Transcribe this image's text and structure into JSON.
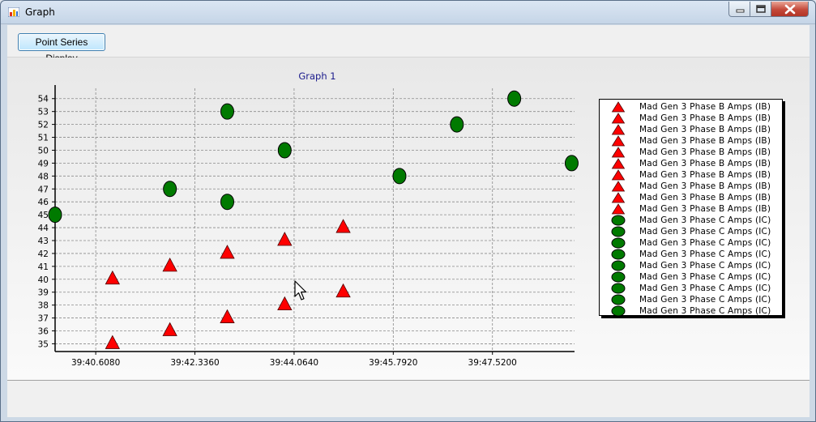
{
  "window": {
    "title": "Graph",
    "minimize_icon": "minimize-icon",
    "maximize_icon": "maximize-icon",
    "close_icon": "close-icon"
  },
  "toolbar": {
    "point_series_label": "Point Series Display"
  },
  "colors": {
    "triangle": "#ff0000",
    "circle": "#007a00",
    "grid": "#8a8a8a",
    "title": "#1a1a8c",
    "close_button": "#c4493a"
  },
  "chart_data": {
    "type": "scatter",
    "title": "Graph 1",
    "xlabel": "",
    "ylabel": "",
    "x_tick_labels": [
      "39:40.6080",
      "39:42.3360",
      "39:44.0640",
      "39:45.7920",
      "39:47.5200"
    ],
    "x_ticks": [
      40.608,
      42.336,
      44.064,
      45.792,
      47.52
    ],
    "xlim": [
      39.9,
      48.95
    ],
    "ylim": [
      34.4,
      54.8
    ],
    "y_ticks": [
      35,
      36,
      37,
      38,
      39,
      40,
      41,
      42,
      43,
      44,
      45,
      46,
      47,
      48,
      49,
      50,
      51,
      52,
      53,
      54
    ],
    "grid": true,
    "legend_position": "right",
    "series": [
      {
        "name": "Mad Gen 3 Phase B Amps (IB)",
        "marker": "triangle",
        "points": [
          {
            "x": 40.9,
            "y": 40
          },
          {
            "x": 40.9,
            "y": 35
          },
          {
            "x": 41.9,
            "y": 41
          },
          {
            "x": 41.9,
            "y": 36
          },
          {
            "x": 42.9,
            "y": 42
          },
          {
            "x": 42.9,
            "y": 37
          },
          {
            "x": 43.9,
            "y": 43
          },
          {
            "x": 43.9,
            "y": 38
          },
          {
            "x": 44.92,
            "y": 44
          },
          {
            "x": 44.92,
            "y": 39
          }
        ]
      },
      {
        "name": "Mad Gen 3 Phase C Amps (IC)",
        "marker": "circle",
        "points": [
          {
            "x": 39.9,
            "y": 45
          },
          {
            "x": 41.9,
            "y": 47
          },
          {
            "x": 42.9,
            "y": 46
          },
          {
            "x": 42.9,
            "y": 53
          },
          {
            "x": 43.9,
            "y": 50
          },
          {
            "x": 45.9,
            "y": 48
          },
          {
            "x": 46.9,
            "y": 52
          },
          {
            "x": 47.9,
            "y": 54
          },
          {
            "x": 48.9,
            "y": 49
          }
        ]
      }
    ]
  },
  "legend": {
    "entries": [
      {
        "label": "Mad Gen 3 Phase B Amps (IB)",
        "marker": "triangle"
      },
      {
        "label": "Mad Gen 3 Phase B Amps (IB)",
        "marker": "triangle"
      },
      {
        "label": "Mad Gen 3 Phase B Amps (IB)",
        "marker": "triangle"
      },
      {
        "label": "Mad Gen 3 Phase B Amps (IB)",
        "marker": "triangle"
      },
      {
        "label": "Mad Gen 3 Phase B Amps (IB)",
        "marker": "triangle"
      },
      {
        "label": "Mad Gen 3 Phase B Amps (IB)",
        "marker": "triangle"
      },
      {
        "label": "Mad Gen 3 Phase B Amps (IB)",
        "marker": "triangle"
      },
      {
        "label": "Mad Gen 3 Phase B Amps (IB)",
        "marker": "triangle"
      },
      {
        "label": "Mad Gen 3 Phase B Amps (IB)",
        "marker": "triangle"
      },
      {
        "label": "Mad Gen 3 Phase B Amps (IB)",
        "marker": "triangle"
      },
      {
        "label": "Mad Gen 3 Phase C Amps (IC)",
        "marker": "circle"
      },
      {
        "label": "Mad Gen 3 Phase C Amps (IC)",
        "marker": "circle"
      },
      {
        "label": "Mad Gen 3 Phase C Amps (IC)",
        "marker": "circle"
      },
      {
        "label": "Mad Gen 3 Phase C Amps (IC)",
        "marker": "circle"
      },
      {
        "label": "Mad Gen 3 Phase C Amps (IC)",
        "marker": "circle"
      },
      {
        "label": "Mad Gen 3 Phase C Amps (IC)",
        "marker": "circle"
      },
      {
        "label": "Mad Gen 3 Phase C Amps (IC)",
        "marker": "circle"
      },
      {
        "label": "Mad Gen 3 Phase C Amps (IC)",
        "marker": "circle"
      },
      {
        "label": "Mad Gen 3 Phase C Amps (IC)",
        "marker": "circle"
      }
    ]
  }
}
